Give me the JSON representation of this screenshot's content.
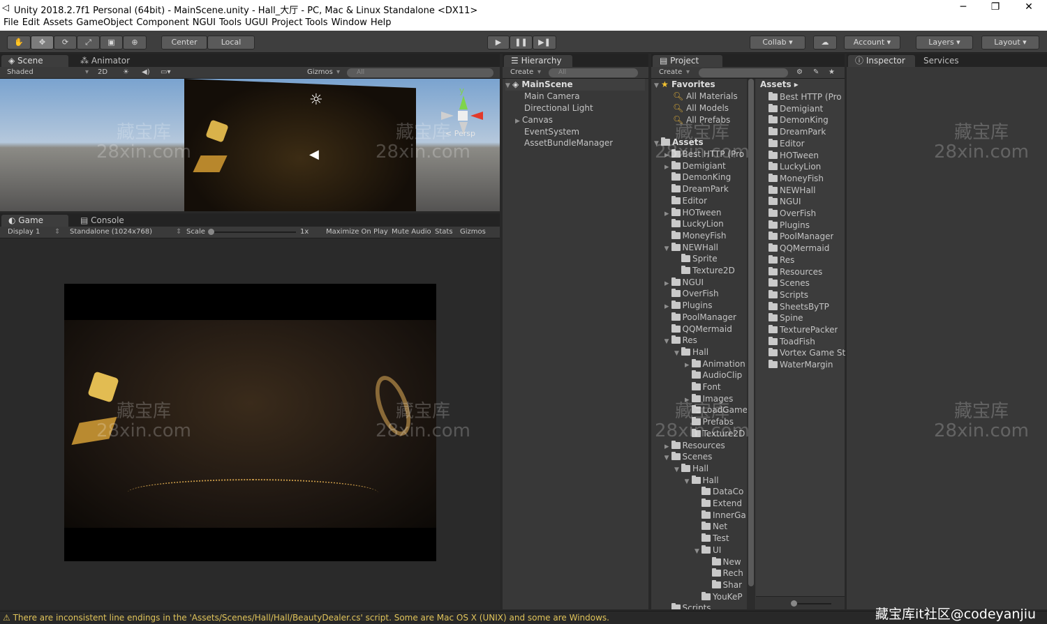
{
  "window": {
    "title": "Unity 2018.2.7f1 Personal (64bit) - MainScene.unity - Hall_大厅 - PC, Mac & Linux Standalone <DX11>",
    "minimize": "─",
    "maximize": "❐",
    "close": "✕"
  },
  "menu": [
    "File",
    "Edit",
    "Assets",
    "GameObject",
    "Component",
    "NGUI",
    "Tools",
    "UGUI",
    "Project Tools",
    "Window",
    "Help"
  ],
  "toolbar": {
    "center_label": "Center",
    "local_label": "Local",
    "collab_label": "Collab",
    "account_label": "Account",
    "layers_label": "Layers",
    "layout_label": "Layout",
    "play_icon": "▶",
    "pause_icon": "❚❚",
    "step_icon": "▶❚"
  },
  "scene": {
    "tabs": [
      "Scene",
      "Animator"
    ],
    "shading": "Shaded",
    "mode2d": "2D",
    "gizmos": "Gizmos",
    "search_placeholder": "All",
    "persp_label": "Persp"
  },
  "game": {
    "tabs": [
      "Game",
      "Console"
    ],
    "display": "Display 1",
    "resolution": "Standalone (1024x768)",
    "scale_label": "Scale",
    "scale_value": "1x",
    "maximize": "Maximize On Play",
    "mute": "Mute Audio",
    "stats": "Stats",
    "gizmos": "Gizmos"
  },
  "hierarchy": {
    "tab": "Hierarchy",
    "create": "Create",
    "search_placeholder": "All",
    "scene": "MainScene",
    "items": [
      "Main Camera",
      "Directional Light",
      "Canvas",
      "EventSystem",
      "AssetBundleManager"
    ]
  },
  "project": {
    "tab": "Project",
    "create": "Create",
    "favorites_label": "Favorites",
    "favorites": [
      "All Materials",
      "All Models",
      "All Prefabs"
    ],
    "assets_label": "Assets",
    "tree": [
      "Best HTTP (Pro",
      "Demigiant",
      "DemonKing",
      "DreamPark",
      "Editor",
      "HOTween",
      "LuckyLion",
      "MoneyFish",
      "NEWHall",
      "Sprite",
      "Texture2D",
      "NGUI",
      "OverFish",
      "Plugins",
      "PoolManager",
      "QQMermaid",
      "Res",
      "Hall",
      "Animation",
      "AudioClip",
      "Font",
      "Images",
      "LoadGame",
      "Prefabs",
      "Texture2D",
      "Resources",
      "Scenes",
      "Hall",
      "Hall",
      "DataCo",
      "Extend",
      "InnerGa",
      "Net",
      "Test",
      "UI",
      "New",
      "Rech",
      "Shar",
      "YouKeP",
      "Scripts"
    ],
    "breadcrumb": "Assets",
    "list": [
      "Best HTTP (Pro",
      "Demigiant",
      "DemonKing",
      "DreamPark",
      "Editor",
      "HOTween",
      "LuckyLion",
      "MoneyFish",
      "NEWHall",
      "NGUI",
      "OverFish",
      "Plugins",
      "PoolManager",
      "QQMermaid",
      "Res",
      "Resources",
      "Scenes",
      "Scripts",
      "SheetsByTP",
      "Spine",
      "TexturePacker",
      "ToadFish",
      "Vortex Game St",
      "WaterMargin"
    ]
  },
  "inspector": {
    "tabs": [
      "Inspector",
      "Services"
    ]
  },
  "status": {
    "message": "There are inconsistent line endings in the 'Assets/Scenes/Hall/Hall/BeautyDealer.cs' script. Some are Mac OS X (UNIX) and some are Windows.",
    "warning_icon": "⚠"
  },
  "watermark": {
    "line1": "藏宝库",
    "line2": "28xin.com",
    "corner": "藏宝库it社区@codeyanjiu"
  }
}
